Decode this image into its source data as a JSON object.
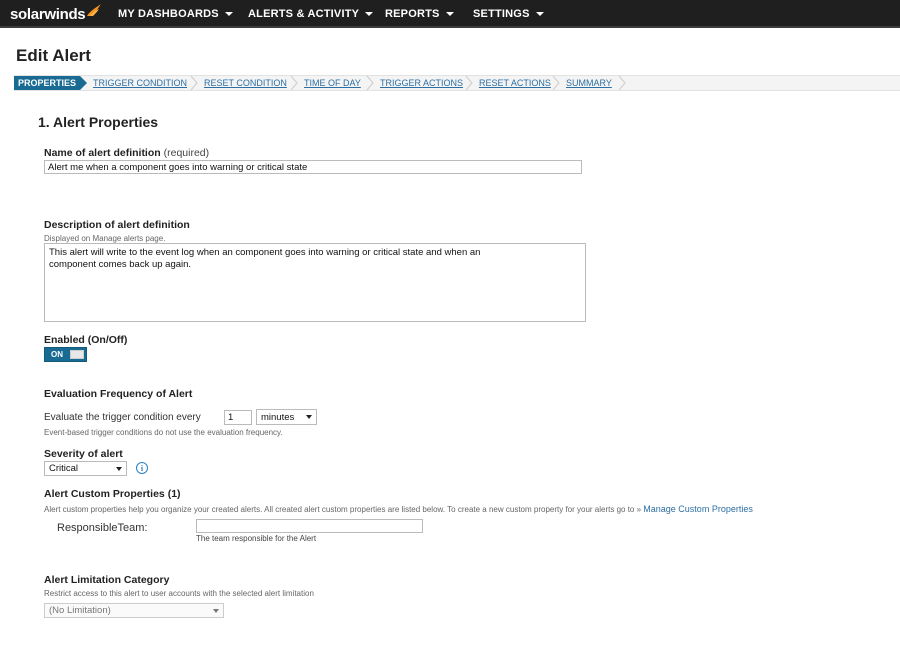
{
  "brand": {
    "name": "solarwinds"
  },
  "nav": [
    {
      "label": "MY DASHBOARDS"
    },
    {
      "label": "ALERTS & ACTIVITY"
    },
    {
      "label": "REPORTS"
    },
    {
      "label": "SETTINGS"
    }
  ],
  "page": {
    "title": "Edit Alert"
  },
  "wizard": {
    "steps": [
      {
        "label": "PROPERTIES",
        "active": true
      },
      {
        "label": "TRIGGER CONDITION"
      },
      {
        "label": "RESET CONDITION"
      },
      {
        "label": "TIME OF DAY"
      },
      {
        "label": "TRIGGER ACTIONS"
      },
      {
        "label": "RESET ACTIONS"
      },
      {
        "label": "SUMMARY"
      }
    ]
  },
  "form": {
    "section_title": "1. Alert Properties",
    "name": {
      "label": "Name of alert definition",
      "required_text": "(required)",
      "value": "Alert me when a component goes into warning or critical state"
    },
    "description": {
      "label": "Description of alert definition",
      "hint": "Displayed on Manage alerts page.",
      "value": "This alert will write to the event log when an component goes into warning or critical state and when an\ncomponent comes back up again."
    },
    "enabled": {
      "label": "Enabled (On/Off)",
      "state": "ON"
    },
    "evaluation": {
      "label": "Evaluation Frequency of Alert",
      "prefix": "Evaluate the trigger condition every",
      "value": "1",
      "unit": "minutes",
      "hint": "Event-based trigger conditions do not use the evaluation frequency."
    },
    "severity": {
      "label": "Severity of alert",
      "value": "Critical",
      "info_icon": "info-icon"
    },
    "custom_props": {
      "label": "Alert Custom Properties (1)",
      "hint": "Alert custom properties help you organize your created alerts. All created alert custom properties are listed below. To create a new custom property for your alerts go to »",
      "link": "Manage Custom Properties",
      "items": [
        {
          "name": "ResponsibleTeam:",
          "value": "",
          "hint": "The team responsible for the Alert"
        }
      ]
    },
    "limitation": {
      "label": "Alert Limitation Category",
      "hint": "Restrict access to this alert to user accounts with the selected alert limitation",
      "value": "(No Limitation)"
    }
  }
}
